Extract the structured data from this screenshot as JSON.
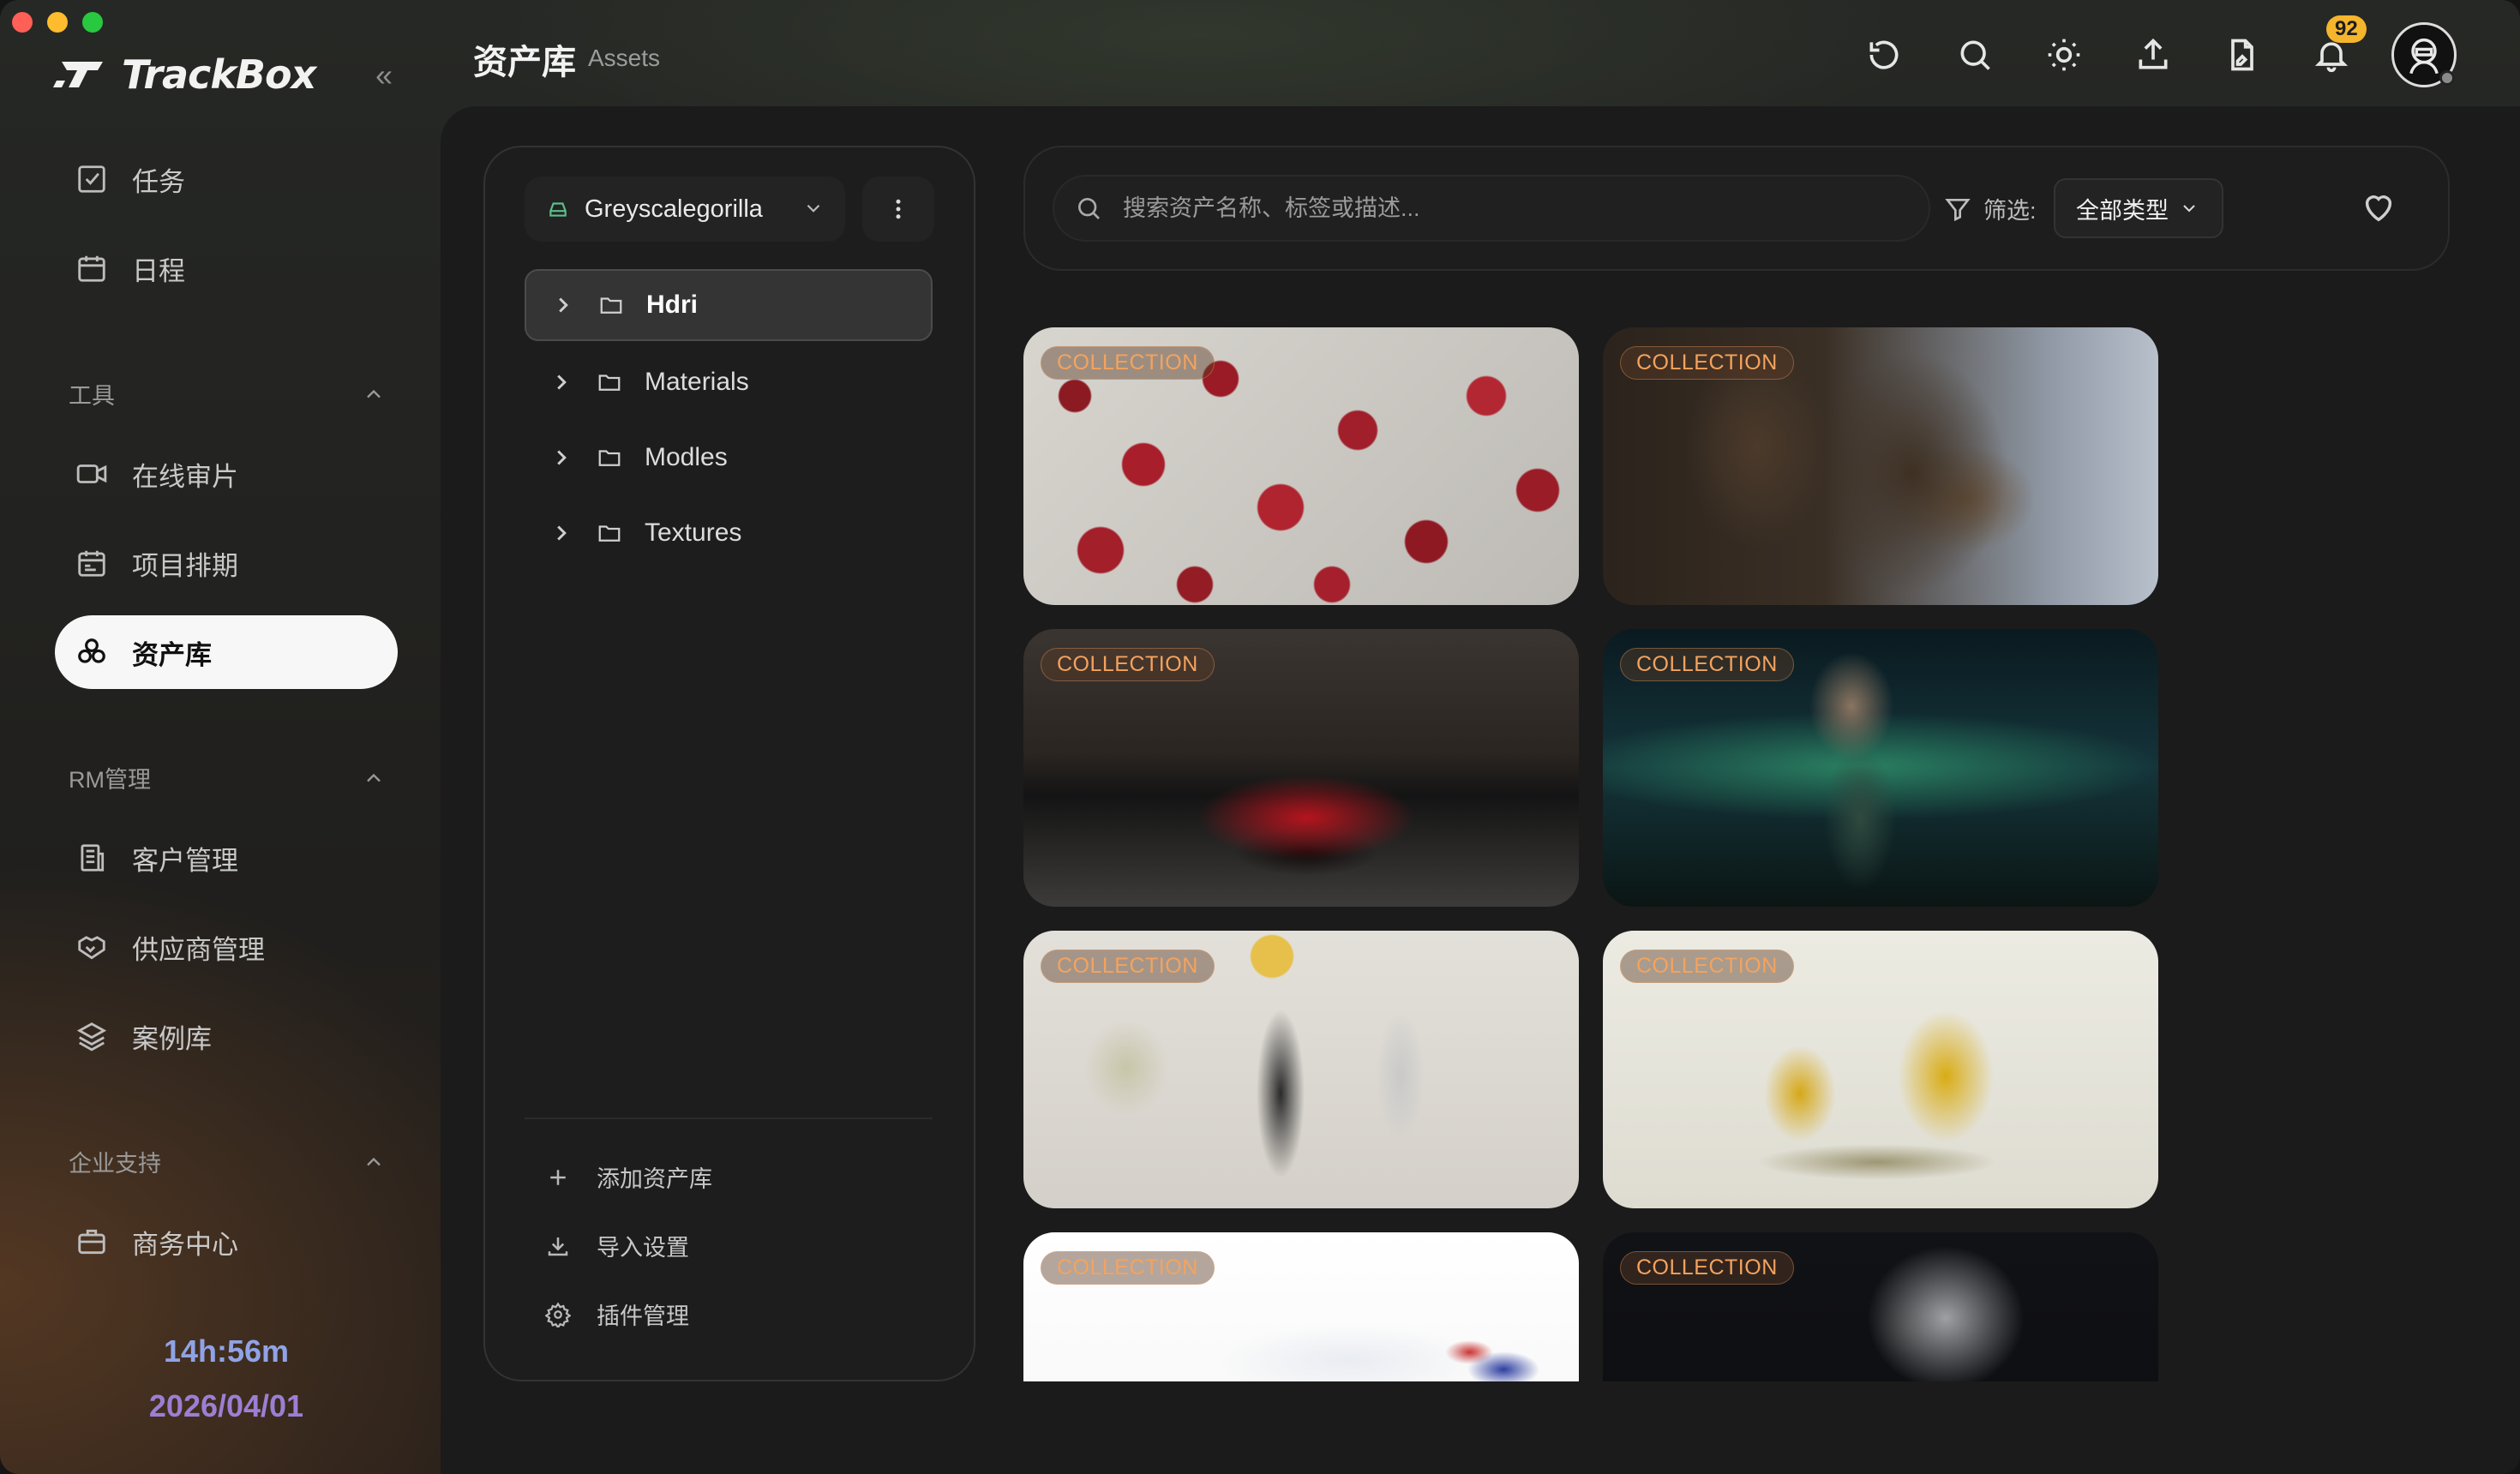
{
  "app": {
    "name": "TrackBox"
  },
  "sidebar": {
    "top_items": [
      {
        "label": "任务",
        "icon": "task-check-icon"
      },
      {
        "label": "日程",
        "icon": "calendar-icon"
      }
    ],
    "sections": [
      {
        "label": "工具",
        "items": [
          {
            "label": "在线审片",
            "icon": "video-camera-icon"
          },
          {
            "label": "项目排期",
            "icon": "schedule-icon"
          },
          {
            "label": "资产库",
            "icon": "assets-icon",
            "active": true
          }
        ]
      },
      {
        "label": "RM管理",
        "items": [
          {
            "label": "客户管理",
            "icon": "building-icon"
          },
          {
            "label": "供应商管理",
            "icon": "handshake-icon"
          },
          {
            "label": "案例库",
            "icon": "layers-icon"
          }
        ]
      },
      {
        "label": "企业支持",
        "items": [
          {
            "label": "商务中心",
            "icon": "briefcase-icon"
          }
        ]
      }
    ],
    "timer": {
      "time": "14h:56m",
      "date": "2026/04/01"
    }
  },
  "header": {
    "title": "资产库",
    "subtitle": "Assets",
    "notification_count": "92",
    "icons": [
      "refresh-icon",
      "search-icon",
      "sun-icon",
      "upload-icon",
      "file-sign-icon",
      "bell-icon"
    ]
  },
  "library": {
    "selected": "Greyscalegorilla",
    "folders": [
      "Hdri",
      "Materials",
      "Modles",
      "Textures"
    ],
    "selected_folder": "Hdri",
    "actions": [
      {
        "label": "添加资产库",
        "icon": "plus-icon"
      },
      {
        "label": "导入设置",
        "icon": "download-icon"
      },
      {
        "label": "插件管理",
        "icon": "gear-icon"
      }
    ]
  },
  "search": {
    "placeholder": "搜索资产名称、标签或描述...",
    "filter_label": "筛选:",
    "type_value": "全部类型"
  },
  "gallery": {
    "tag": "COLLECTION",
    "cards": [
      {
        "image": "cherries"
      },
      {
        "image": "bronze-statue"
      },
      {
        "image": "red-sports-car-night"
      },
      {
        "image": "skull-robot-aurora"
      },
      {
        "image": "sculpture-shapes"
      },
      {
        "image": "yellow-vases"
      },
      {
        "image": "rally-car"
      },
      {
        "image": "chrome-skull"
      }
    ]
  }
}
